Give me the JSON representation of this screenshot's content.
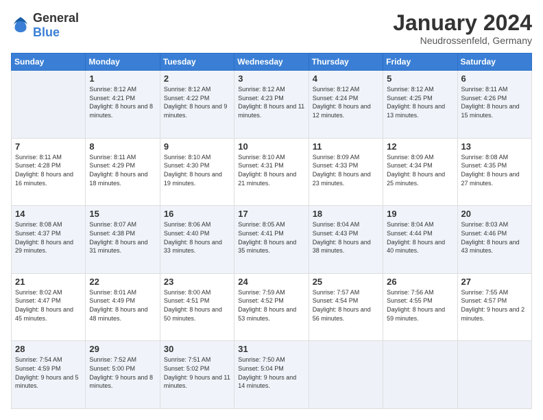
{
  "logo": {
    "general": "General",
    "blue": "Blue"
  },
  "title": "January 2024",
  "subtitle": "Neudrossenfeld, Germany",
  "weekdays": [
    "Sunday",
    "Monday",
    "Tuesday",
    "Wednesday",
    "Thursday",
    "Friday",
    "Saturday"
  ],
  "weeks": [
    [
      {
        "day": "",
        "sunrise": "",
        "sunset": "",
        "daylight": ""
      },
      {
        "day": "1",
        "sunrise": "Sunrise: 8:12 AM",
        "sunset": "Sunset: 4:21 PM",
        "daylight": "Daylight: 8 hours and 8 minutes."
      },
      {
        "day": "2",
        "sunrise": "Sunrise: 8:12 AM",
        "sunset": "Sunset: 4:22 PM",
        "daylight": "Daylight: 8 hours and 9 minutes."
      },
      {
        "day": "3",
        "sunrise": "Sunrise: 8:12 AM",
        "sunset": "Sunset: 4:23 PM",
        "daylight": "Daylight: 8 hours and 11 minutes."
      },
      {
        "day": "4",
        "sunrise": "Sunrise: 8:12 AM",
        "sunset": "Sunset: 4:24 PM",
        "daylight": "Daylight: 8 hours and 12 minutes."
      },
      {
        "day": "5",
        "sunrise": "Sunrise: 8:12 AM",
        "sunset": "Sunset: 4:25 PM",
        "daylight": "Daylight: 8 hours and 13 minutes."
      },
      {
        "day": "6",
        "sunrise": "Sunrise: 8:11 AM",
        "sunset": "Sunset: 4:26 PM",
        "daylight": "Daylight: 8 hours and 15 minutes."
      }
    ],
    [
      {
        "day": "7",
        "sunrise": "Sunrise: 8:11 AM",
        "sunset": "Sunset: 4:28 PM",
        "daylight": "Daylight: 8 hours and 16 minutes."
      },
      {
        "day": "8",
        "sunrise": "Sunrise: 8:11 AM",
        "sunset": "Sunset: 4:29 PM",
        "daylight": "Daylight: 8 hours and 18 minutes."
      },
      {
        "day": "9",
        "sunrise": "Sunrise: 8:10 AM",
        "sunset": "Sunset: 4:30 PM",
        "daylight": "Daylight: 8 hours and 19 minutes."
      },
      {
        "day": "10",
        "sunrise": "Sunrise: 8:10 AM",
        "sunset": "Sunset: 4:31 PM",
        "daylight": "Daylight: 8 hours and 21 minutes."
      },
      {
        "day": "11",
        "sunrise": "Sunrise: 8:09 AM",
        "sunset": "Sunset: 4:33 PM",
        "daylight": "Daylight: 8 hours and 23 minutes."
      },
      {
        "day": "12",
        "sunrise": "Sunrise: 8:09 AM",
        "sunset": "Sunset: 4:34 PM",
        "daylight": "Daylight: 8 hours and 25 minutes."
      },
      {
        "day": "13",
        "sunrise": "Sunrise: 8:08 AM",
        "sunset": "Sunset: 4:35 PM",
        "daylight": "Daylight: 8 hours and 27 minutes."
      }
    ],
    [
      {
        "day": "14",
        "sunrise": "Sunrise: 8:08 AM",
        "sunset": "Sunset: 4:37 PM",
        "daylight": "Daylight: 8 hours and 29 minutes."
      },
      {
        "day": "15",
        "sunrise": "Sunrise: 8:07 AM",
        "sunset": "Sunset: 4:38 PM",
        "daylight": "Daylight: 8 hours and 31 minutes."
      },
      {
        "day": "16",
        "sunrise": "Sunrise: 8:06 AM",
        "sunset": "Sunset: 4:40 PM",
        "daylight": "Daylight: 8 hours and 33 minutes."
      },
      {
        "day": "17",
        "sunrise": "Sunrise: 8:05 AM",
        "sunset": "Sunset: 4:41 PM",
        "daylight": "Daylight: 8 hours and 35 minutes."
      },
      {
        "day": "18",
        "sunrise": "Sunrise: 8:04 AM",
        "sunset": "Sunset: 4:43 PM",
        "daylight": "Daylight: 8 hours and 38 minutes."
      },
      {
        "day": "19",
        "sunrise": "Sunrise: 8:04 AM",
        "sunset": "Sunset: 4:44 PM",
        "daylight": "Daylight: 8 hours and 40 minutes."
      },
      {
        "day": "20",
        "sunrise": "Sunrise: 8:03 AM",
        "sunset": "Sunset: 4:46 PM",
        "daylight": "Daylight: 8 hours and 43 minutes."
      }
    ],
    [
      {
        "day": "21",
        "sunrise": "Sunrise: 8:02 AM",
        "sunset": "Sunset: 4:47 PM",
        "daylight": "Daylight: 8 hours and 45 minutes."
      },
      {
        "day": "22",
        "sunrise": "Sunrise: 8:01 AM",
        "sunset": "Sunset: 4:49 PM",
        "daylight": "Daylight: 8 hours and 48 minutes."
      },
      {
        "day": "23",
        "sunrise": "Sunrise: 8:00 AM",
        "sunset": "Sunset: 4:51 PM",
        "daylight": "Daylight: 8 hours and 50 minutes."
      },
      {
        "day": "24",
        "sunrise": "Sunrise: 7:59 AM",
        "sunset": "Sunset: 4:52 PM",
        "daylight": "Daylight: 8 hours and 53 minutes."
      },
      {
        "day": "25",
        "sunrise": "Sunrise: 7:57 AM",
        "sunset": "Sunset: 4:54 PM",
        "daylight": "Daylight: 8 hours and 56 minutes."
      },
      {
        "day": "26",
        "sunrise": "Sunrise: 7:56 AM",
        "sunset": "Sunset: 4:55 PM",
        "daylight": "Daylight: 8 hours and 59 minutes."
      },
      {
        "day": "27",
        "sunrise": "Sunrise: 7:55 AM",
        "sunset": "Sunset: 4:57 PM",
        "daylight": "Daylight: 9 hours and 2 minutes."
      }
    ],
    [
      {
        "day": "28",
        "sunrise": "Sunrise: 7:54 AM",
        "sunset": "Sunset: 4:59 PM",
        "daylight": "Daylight: 9 hours and 5 minutes."
      },
      {
        "day": "29",
        "sunrise": "Sunrise: 7:52 AM",
        "sunset": "Sunset: 5:00 PM",
        "daylight": "Daylight: 9 hours and 8 minutes."
      },
      {
        "day": "30",
        "sunrise": "Sunrise: 7:51 AM",
        "sunset": "Sunset: 5:02 PM",
        "daylight": "Daylight: 9 hours and 11 minutes."
      },
      {
        "day": "31",
        "sunrise": "Sunrise: 7:50 AM",
        "sunset": "Sunset: 5:04 PM",
        "daylight": "Daylight: 9 hours and 14 minutes."
      },
      {
        "day": "",
        "sunrise": "",
        "sunset": "",
        "daylight": ""
      },
      {
        "day": "",
        "sunrise": "",
        "sunset": "",
        "daylight": ""
      },
      {
        "day": "",
        "sunrise": "",
        "sunset": "",
        "daylight": ""
      }
    ]
  ]
}
